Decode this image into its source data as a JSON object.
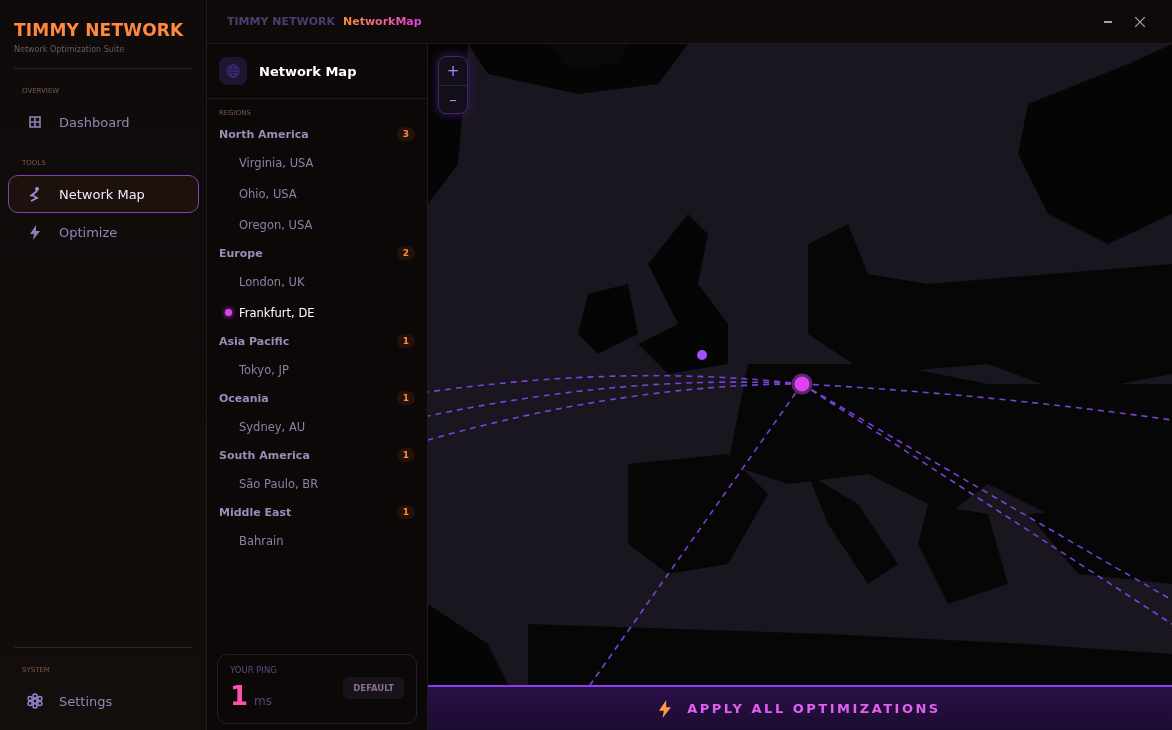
{
  "brand": {
    "title": "TIMMY NETWORK",
    "subtitle": "Network Optimization Suite"
  },
  "sidebar": {
    "sections": [
      {
        "label": "OVERVIEW",
        "items": [
          {
            "label": "Dashboard",
            "selected": false
          }
        ]
      },
      {
        "label": "TOOLS",
        "items": [
          {
            "label": "Network Map",
            "selected": true
          },
          {
            "label": "Optimize",
            "selected": false
          }
        ]
      },
      {
        "label": "SYSTEM",
        "items": [
          {
            "label": "Settings",
            "selected": false
          }
        ]
      }
    ]
  },
  "breadcrumb": [
    "TIMMY NETWORK",
    "NetworkMap"
  ],
  "panel": {
    "title": "Network Map",
    "regions_label": "REGIONS",
    "regions": [
      {
        "name": "North America",
        "count": "3",
        "children": [
          {
            "label": "Virginia, USA",
            "selected": false
          },
          {
            "label": "Ohio, USA",
            "selected": false
          },
          {
            "label": "Oregon, USA",
            "selected": false
          }
        ]
      },
      {
        "name": "Europe",
        "count": "2",
        "children": [
          {
            "label": "London, UK",
            "selected": false
          },
          {
            "label": "Frankfurt, DE",
            "selected": true
          }
        ]
      },
      {
        "name": "Asia Pacific",
        "count": "1",
        "children": [
          {
            "label": "Tokyo, JP",
            "selected": false
          }
        ]
      },
      {
        "name": "Oceania",
        "count": "1",
        "children": [
          {
            "label": "Sydney, AU",
            "selected": false
          }
        ]
      },
      {
        "name": "South America",
        "count": "1",
        "children": [
          {
            "label": "São Paulo, BR",
            "selected": false
          }
        ]
      },
      {
        "name": "Middle East",
        "count": "1",
        "children": [
          {
            "label": "Bahrain",
            "selected": false
          }
        ]
      }
    ],
    "ping": {
      "label": "YOUR PING",
      "value": "1",
      "unit": "ms",
      "button": "DEFAULT"
    }
  },
  "map": {
    "kind": "picture",
    "zoom_in": "+",
    "zoom_out": "–"
  },
  "apply_button": "APPLY ALL OPTIMIZATIONS"
}
